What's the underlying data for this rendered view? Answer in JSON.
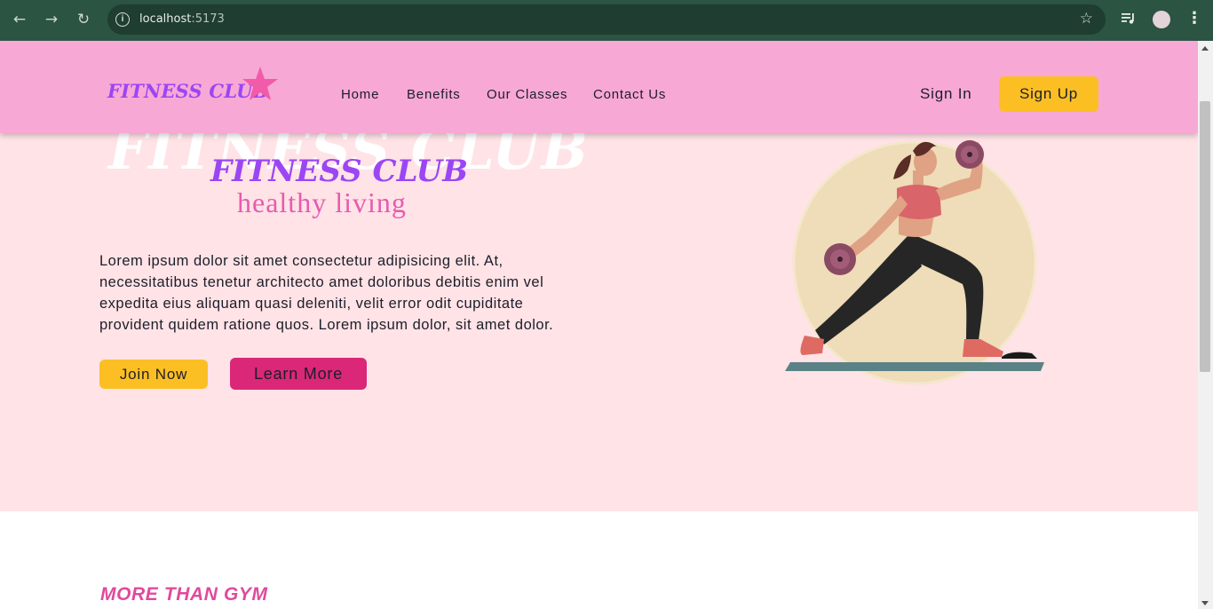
{
  "browser": {
    "url_host": "localhost",
    "url_port": ":5173",
    "icons": [
      "back-arrow-icon",
      "forward-arrow-icon",
      "reload-icon",
      "site-info-icon",
      "bookmark-star-icon",
      "media-control-icon",
      "profile-avatar",
      "more-menu-icon"
    ]
  },
  "header": {
    "logo": "FITNESS CLUB",
    "nav": [
      "Home",
      "Benefits",
      "Our Classes",
      "Contact Us"
    ],
    "sign_in": "Sign In",
    "sign_up": "Sign Up"
  },
  "hero": {
    "background_title": "FITNESS CLUB",
    "title": "FITNESS CLUB",
    "subtitle": "healthy living",
    "description": "Lorem ipsum dolor sit amet consectetur adipisicing elit. At, necessitatibus tenetur architecto amet doloribus debitis enim vel expedita eius aliquam quasi deleniti, velit error odit cupiditate provident quidem ratione quos. Lorem ipsum dolor, sit amet dolor.",
    "join_button": "Join Now",
    "learn_button": "Learn More"
  },
  "section": {
    "title": "MORE THAN GYM"
  },
  "colors": {
    "chrome": "#2b5442",
    "header_bg": "#f8a8d5",
    "hero_bg": "#ffe3e6",
    "purple": "#9b46f5",
    "pink": "#e85ab0",
    "yellow": "#fbbf24",
    "magenta": "#db2777"
  }
}
